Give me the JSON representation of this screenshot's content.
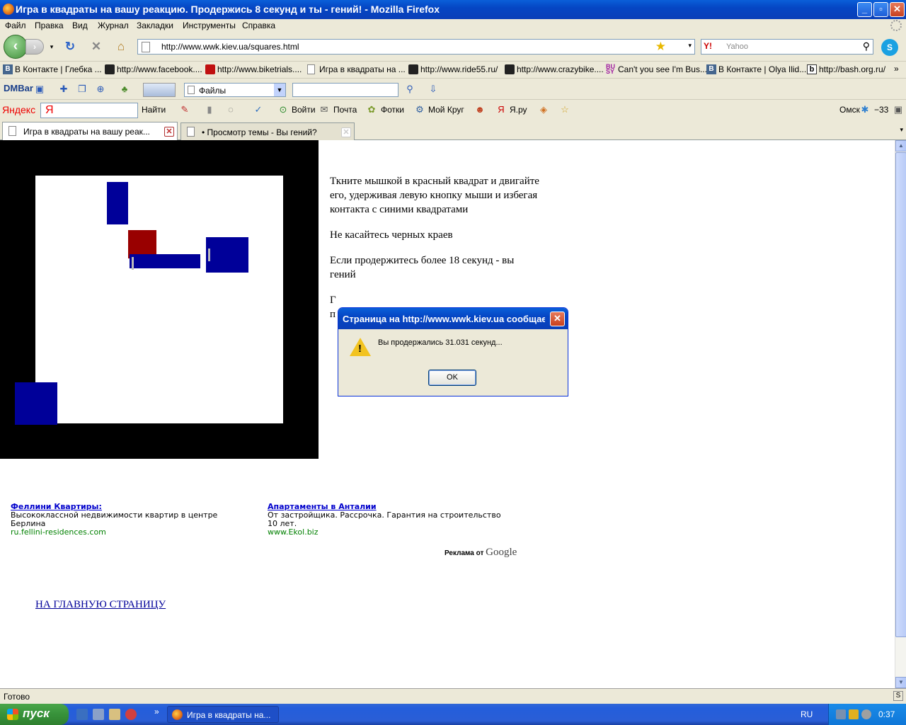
{
  "window": {
    "title": "Игра в квадраты на вашу реакцию. Продержись 8 секунд и ты - гений! - Mozilla Firefox"
  },
  "menu": [
    "Файл",
    "Правка",
    "Вид",
    "Журнал",
    "Закладки",
    "Инструменты",
    "Справка"
  ],
  "nav": {
    "url": "http://www.wwk.kiev.ua/squares.html",
    "search_placeholder": "Yahoo",
    "search_engine": "Y!"
  },
  "bookmarks": [
    "В Контакте | Глебка ...",
    "http://www.facebook....",
    "http://www.biketrials....",
    "Игра в квадраты на ...",
    "http://www.ride55.ru/",
    "http://www.crazybike....",
    "Can't you see I'm Bus...",
    "В Контакте | Olya Ilid...",
    "http://bash.org.ru/"
  ],
  "dmbar": {
    "logo": "DMBar",
    "select_value": "Файлы"
  },
  "yandex": {
    "logo": "Яндекс",
    "find": "Найти",
    "login": "Войти",
    "mail": "Почта",
    "photos": "Фотки",
    "my_circle": "Мой Круг",
    "yaru": "Я.ру",
    "city": "Омск",
    "temp": "−33"
  },
  "tabs": [
    {
      "label": "Игра в квадраты на вашу реак..."
    },
    {
      "label": "• Просмотр темы - Вы гений?"
    }
  ],
  "page": {
    "instructions": [
      "Ткните мышкой в красный квадрат и двигайте его, удерживая левую кнопку мыши и избегая контакта с синими квадратами",
      "Не касайтесь черных краев",
      "Если продержитесь более 18 секунд - вы гений"
    ],
    "hidden_line": "Г",
    "hidden_line2": "п",
    "ads": [
      {
        "title": "Феллини Квартиры:",
        "text": "Высококлассной недвижимости квартир в центре Берлина",
        "url": "ru.fellini-residences.com"
      },
      {
        "title": "Апартаменты в Анталии",
        "text": "От застройщика. Рассрочка. Гарантия на строительство 10 лет.",
        "url": "www.Ekol.biz"
      }
    ],
    "ads_by": "Реклама от",
    "google": "Google",
    "home_link": "НА ГЛАВНУЮ СТРАНИЦУ"
  },
  "dialog": {
    "title": "Страница на http://www.wwk.kiev.ua сообщает:",
    "message": "Вы продержались 31.031 секунд...",
    "ok": "OK"
  },
  "status": {
    "text": "Готово"
  },
  "taskbar": {
    "start": "пуск",
    "task_title": "Игра в квадраты на...",
    "lang": "RU",
    "clock": "0:37"
  },
  "colors": {
    "blue_square": "#000099",
    "red_square": "#990000",
    "link": "#0000cc",
    "ad_url": "#008000"
  }
}
